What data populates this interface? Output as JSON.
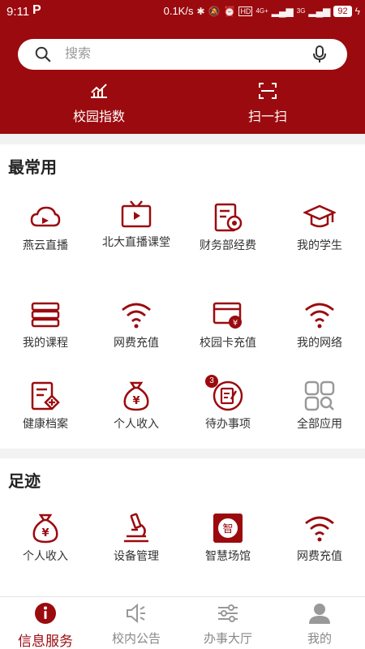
{
  "status": {
    "time": "9:11",
    "app_icon": "P",
    "speed": "0.1K/s",
    "net1": "4G+",
    "net2": "3G",
    "battery": "92"
  },
  "search": {
    "placeholder": "搜索"
  },
  "quick": [
    {
      "label": "校园指数",
      "icon": "chart-icon"
    },
    {
      "label": "扫一扫",
      "icon": "scan-icon"
    }
  ],
  "sections": {
    "common": {
      "title": "最常用",
      "items": [
        {
          "label": "燕云直播",
          "icon": "cloud-live-icon"
        },
        {
          "label": "北大直播课堂",
          "icon": "tv-icon"
        },
        {
          "label": "财务部经费",
          "icon": "finance-icon"
        },
        {
          "label": "我的学生",
          "icon": "graduation-cap-icon"
        },
        {
          "label": "我的课程",
          "icon": "books-icon"
        },
        {
          "label": "网费充值",
          "icon": "wifi-icon"
        },
        {
          "label": "校园卡充值",
          "icon": "card-icon"
        },
        {
          "label": "我的网络",
          "icon": "wifi-icon"
        },
        {
          "label": "健康档案",
          "icon": "health-record-icon"
        },
        {
          "label": "个人收入",
          "icon": "money-bag-icon"
        },
        {
          "label": "待办事项",
          "icon": "todo-icon",
          "badge": "3"
        },
        {
          "label": "全部应用",
          "icon": "all-apps-icon"
        }
      ]
    },
    "footprint": {
      "title": "足迹",
      "items": [
        {
          "label": "个人收入",
          "icon": "money-bag-icon"
        },
        {
          "label": "设备管理",
          "icon": "microscope-icon"
        },
        {
          "label": "智慧场馆",
          "icon": "venue-icon"
        },
        {
          "label": "网费充值",
          "icon": "wifi-icon"
        }
      ]
    }
  },
  "nav": [
    {
      "label": "信息服务",
      "active": true
    },
    {
      "label": "校内公告",
      "active": false
    },
    {
      "label": "办事大厅",
      "active": false
    },
    {
      "label": "我的",
      "active": false
    }
  ],
  "colors": {
    "primary": "#9b0a0e",
    "background": "#f2f2f2",
    "inactive": "#888888"
  }
}
